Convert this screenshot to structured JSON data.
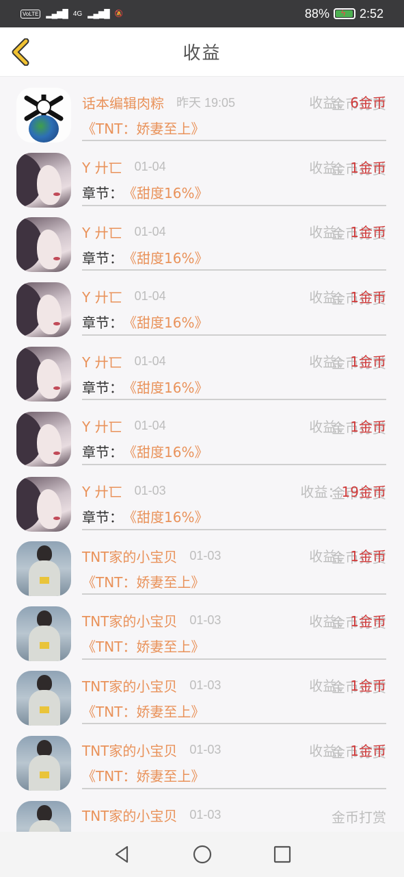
{
  "status": {
    "volte": "VoLTE",
    "network": "4G",
    "battery_pct": "88%",
    "time": "2:52"
  },
  "header": {
    "title": "收益"
  },
  "rows": [
    {
      "avatar": "first",
      "name": "话本编辑肉粽",
      "time": "昨天 19:05",
      "type": "金币打赏",
      "prefix": "",
      "work": "《TNT：娇妻至上》",
      "earn_label": "收益：",
      "earn_value": "6金币"
    },
    {
      "avatar": "girl",
      "name": "Y 廾匸",
      "time": "01-04",
      "type": "金币打赏",
      "prefix": "章节：",
      "work": "《甜度16%》",
      "earn_label": "收益：",
      "earn_value": "1金币"
    },
    {
      "avatar": "girl",
      "name": "Y 廾匸",
      "time": "01-04",
      "type": "金币打赏",
      "prefix": "章节：",
      "work": "《甜度16%》",
      "earn_label": "收益：",
      "earn_value": "1金币"
    },
    {
      "avatar": "girl",
      "name": "Y 廾匸",
      "time": "01-04",
      "type": "金币打赏",
      "prefix": "章节：",
      "work": "《甜度16%》",
      "earn_label": "收益：",
      "earn_value": "1金币"
    },
    {
      "avatar": "girl",
      "name": "Y 廾匸",
      "time": "01-04",
      "type": "金币打赏",
      "prefix": "章节：",
      "work": "《甜度16%》",
      "earn_label": "收益：",
      "earn_value": "1金币"
    },
    {
      "avatar": "girl",
      "name": "Y 廾匸",
      "time": "01-04",
      "type": "金币打赏",
      "prefix": "章节：",
      "work": "《甜度16%》",
      "earn_label": "收益：",
      "earn_value": "1金币"
    },
    {
      "avatar": "girl",
      "name": "Y 廾匸",
      "time": "01-03",
      "type": "金币打赏",
      "prefix": "章节：",
      "work": "《甜度16%》",
      "earn_label": "收益：",
      "earn_value": "19金币"
    },
    {
      "avatar": "boy",
      "name": "TNT家的小宝贝",
      "time": "01-03",
      "type": "金币打赏",
      "prefix": "",
      "work": "《TNT：娇妻至上》",
      "earn_label": "收益：",
      "earn_value": "1金币"
    },
    {
      "avatar": "boy",
      "name": "TNT家的小宝贝",
      "time": "01-03",
      "type": "金币打赏",
      "prefix": "",
      "work": "《TNT：娇妻至上》",
      "earn_label": "收益：",
      "earn_value": "1金币"
    },
    {
      "avatar": "boy",
      "name": "TNT家的小宝贝",
      "time": "01-03",
      "type": "金币打赏",
      "prefix": "",
      "work": "《TNT：娇妻至上》",
      "earn_label": "收益：",
      "earn_value": "1金币"
    },
    {
      "avatar": "boy",
      "name": "TNT家的小宝贝",
      "time": "01-03",
      "type": "金币打赏",
      "prefix": "",
      "work": "《TNT：娇妻至上》",
      "earn_label": "收益：",
      "earn_value": "1金币"
    },
    {
      "avatar": "boy",
      "name": "TNT家的小宝贝",
      "time": "01-03",
      "type": "金币打赏",
      "prefix": "",
      "work": "",
      "earn_label": "",
      "earn_value": ""
    }
  ],
  "colors": {
    "accent_orange": "#e9925a",
    "earn_red": "#d13a3a",
    "back_arrow": "#f1c232"
  },
  "icons": {
    "back": "chevron-left-icon",
    "nav_back": "triangle-back-icon",
    "nav_home": "circle-home-icon",
    "nav_recent": "square-recents-icon"
  }
}
